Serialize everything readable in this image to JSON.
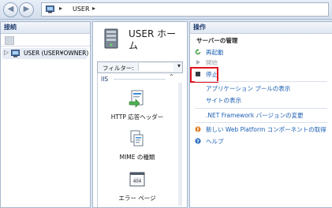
{
  "address_bar": {
    "back_icon": "arrow-left-icon",
    "forward_icon": "arrow-right-icon",
    "breadcrumb": "USER",
    "separator": "▸"
  },
  "connections": {
    "header": "接続",
    "tree": [
      {
        "expander": "▷",
        "label": "USER (USER¥OWNER)",
        "icon": "server-icon"
      }
    ]
  },
  "home": {
    "title": "USER ホーム",
    "filter_label": "フィルター:",
    "section": "IIS",
    "features": [
      {
        "label": "HTTP 応答ヘッダー",
        "icon": "http-response-headers-icon"
      },
      {
        "label": "MIME の種類",
        "icon": "mime-types-icon"
      },
      {
        "label": "エラー ページ",
        "icon": "error-pages-icon"
      }
    ]
  },
  "actions": {
    "header": "操作",
    "group_title": "サーバーの管理",
    "items": [
      {
        "label": "再起動",
        "icon": "restart-icon",
        "enabled": true
      },
      {
        "label": "開始",
        "icon": "start-icon",
        "enabled": false
      },
      {
        "label": "停止",
        "icon": "stop-icon",
        "enabled": true,
        "highlighted": true
      },
      {
        "label": "アプリケーション プールの表示",
        "enabled": true
      },
      {
        "label": "サイトの表示",
        "enabled": true
      },
      {
        "label": ".NET Framework バージョンの変更",
        "enabled": true
      },
      {
        "label": "新しい Web Platform コンポーネントの取得",
        "icon": "web-platform-icon",
        "enabled": true
      },
      {
        "label": "ヘルプ",
        "icon": "help-icon",
        "enabled": true
      }
    ]
  },
  "colors": {
    "link": "#1a5fb4",
    "highlight_border": "#e0141e",
    "header_text": "#1e3a6e"
  }
}
